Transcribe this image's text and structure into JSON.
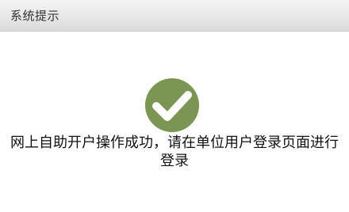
{
  "dialog": {
    "title": "系统提示",
    "icon": "check-circle-icon",
    "icon_color": "#7a9652",
    "message_line1": "网上自助开户操作成功，请在单位用户登录页面进行",
    "message_line2": "登录"
  }
}
